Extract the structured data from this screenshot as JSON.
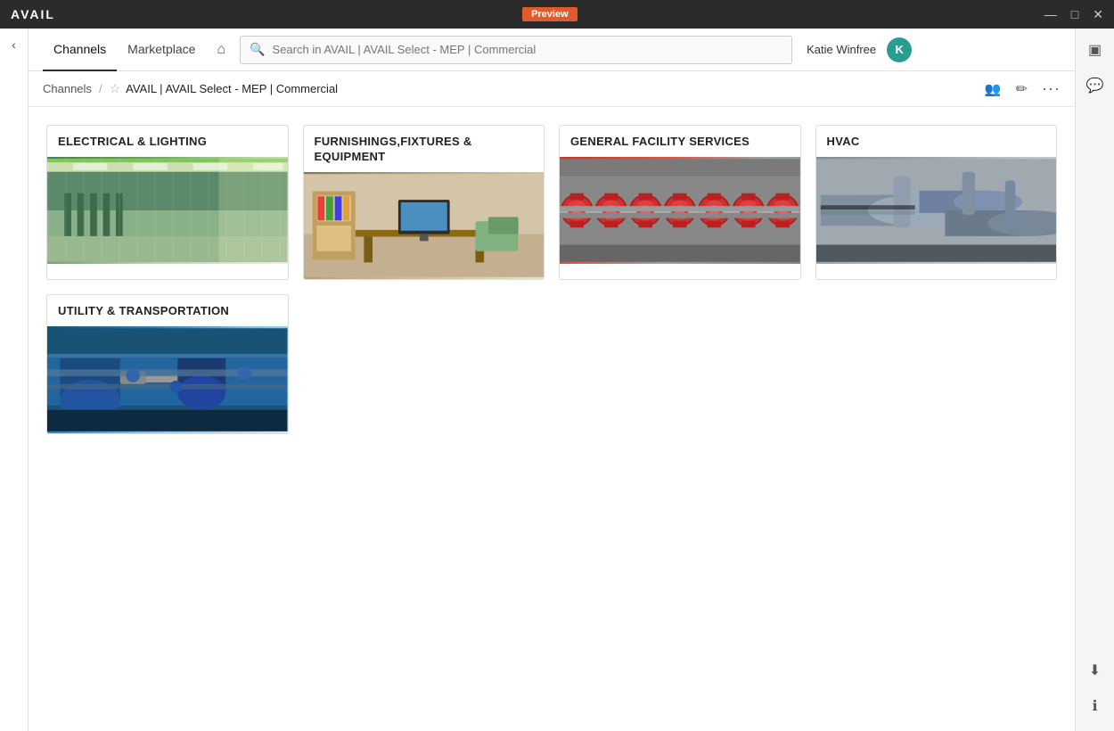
{
  "titleBar": {
    "logo": "AVAIL",
    "preview": "Preview",
    "controls": [
      "minimize",
      "maximize",
      "close"
    ]
  },
  "nav": {
    "tabs": [
      {
        "id": "channels",
        "label": "Channels",
        "active": true
      },
      {
        "id": "marketplace",
        "label": "Marketplace",
        "active": false
      }
    ],
    "search": {
      "placeholder": "Search in AVAIL | AVAIL Select - MEP | Commercial"
    },
    "user": {
      "name": "Katie Winfree",
      "initial": "K"
    }
  },
  "breadcrumb": {
    "root": "Channels",
    "separator": "/",
    "title": "AVAIL | AVAIL Select - MEP | Commercial"
  },
  "categories": [
    {
      "id": "electrical",
      "title": "ELECTRICAL & LIGHTING",
      "imageTheme": "electrical"
    },
    {
      "id": "furnishings",
      "title": "FURNISHINGS,FIXTURES & EQUIPMENT",
      "imageTheme": "furnishings"
    },
    {
      "id": "facility",
      "title": "GENERAL FACILITY SERVICES",
      "imageTheme": "facility"
    },
    {
      "id": "hvac",
      "title": "HVAC",
      "imageTheme": "hvac"
    },
    {
      "id": "utility",
      "title": "UTILITY & TRANSPORTATION",
      "imageTheme": "utility"
    }
  ],
  "icons": {
    "search": "🔍",
    "home": "⌂",
    "star": "☆",
    "users": "👥",
    "edit": "✏",
    "more": "•••",
    "layout": "▣",
    "chat": "💬",
    "download": "⬇",
    "info": "ℹ",
    "chevronRight": "›",
    "minimize": "—",
    "maximize": "□",
    "close": "✕",
    "back": "‹",
    "toggle": "☰"
  }
}
